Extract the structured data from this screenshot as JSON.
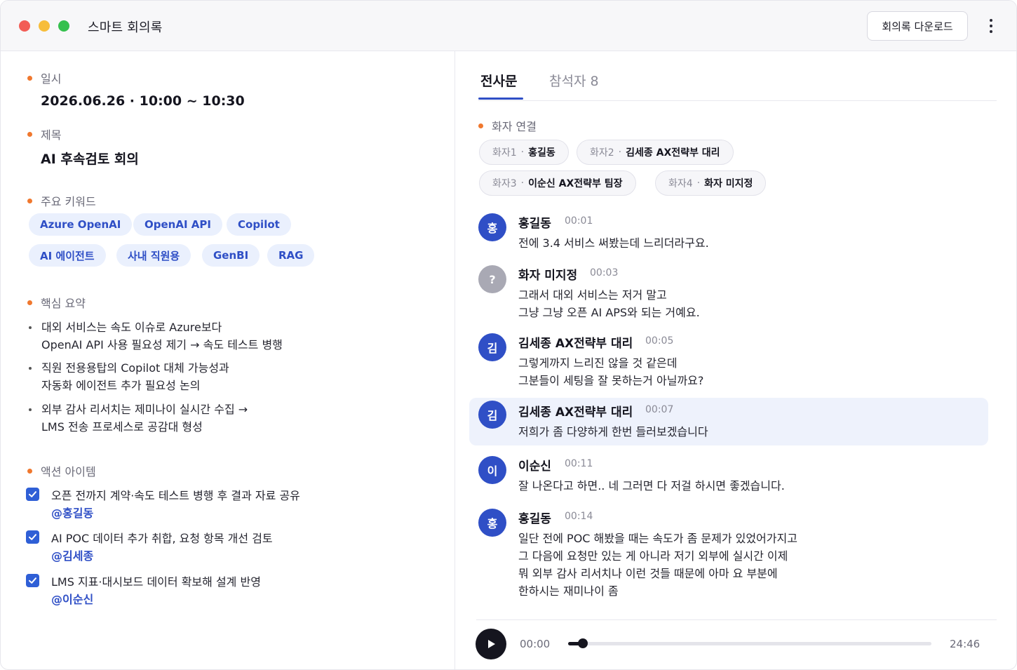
{
  "window": {
    "title": "스마트 회의록",
    "download_label": "회의록 다운로드"
  },
  "meeting": {
    "date_label": "일시",
    "date_value": "2026.06.26 · 10:00 ~ 10:30",
    "title_label": "제목",
    "title_value": "AI 후속검토 회의",
    "keywords_label": "주요 키워드",
    "keywords": [
      "Azure OpenAI",
      "OpenAI API",
      "Copilot",
      "AI 에이전트",
      "사내 직원용",
      "GenBI",
      "RAG"
    ],
    "summary_label": "핵심 요약",
    "summary": [
      {
        "line1": "대외 서비스는 속도 이슈로 Azure보다",
        "line2": "OpenAI API 사용 필요성 제기 → 속도 테스트 병행"
      },
      {
        "line1": "직원 전용용탑의 Copilot 대체 가능성과",
        "line2": "자동화 에이전트 추가 필요성 논의"
      },
      {
        "line1": "외부 감사 리서치는 제미나이 실시간 수집 →",
        "line2": "LMS 전송 프로세스로 공감대 형성"
      }
    ],
    "actions_label": "액션 아이템",
    "actions": [
      {
        "text": "오픈 전까지 계약·속도 테스트 병행 후 결과 자료 공유",
        "mention": "@홍길동",
        "checked": true
      },
      {
        "text": "AI POC 데이터 추가 취합, 요청 항목 개선 검토",
        "mention": "@김세종",
        "checked": true
      },
      {
        "text": "LMS 지표·대시보드 데이터 확보해 설계 반영",
        "mention": "@이순신",
        "checked": true
      }
    ]
  },
  "tabs": {
    "transcript": "전사문",
    "participants": "참석자 8"
  },
  "speakers_label": "화자 연결",
  "speakers": [
    {
      "id": "화자1",
      "name": "홍길동"
    },
    {
      "id": "화자2",
      "name": "김세종 AX전략부 대리"
    },
    {
      "id": "화자3",
      "name": "이순신 AX전략부 팀장"
    },
    {
      "id": "화자4",
      "name": "화자 미지정"
    }
  ],
  "transcript": [
    {
      "avatar": "홍",
      "name": "홍길동",
      "time": "00:01",
      "lines": [
        "전에 3.4 서비스 써봤는데 느리더라구요."
      ],
      "highlight": false
    },
    {
      "avatar": "?",
      "name": "화자 미지정",
      "time": "00:03",
      "lines": [
        "그래서 대외 서비스는 저거 말고",
        "그냥 그냥 오픈 AI APS와 되는 거예요."
      ],
      "highlight": false
    },
    {
      "avatar": "김",
      "name": "김세종 AX전략부 대리",
      "time": "00:05",
      "lines": [
        "그렇게까지 느리진 않을 것 같은데",
        "그분들이 세팅을 잘 못하는거 아닐까요?"
      ],
      "highlight": false
    },
    {
      "avatar": "김",
      "name": "김세종 AX전략부 대리",
      "time": "00:07",
      "lines": [
        "저희가 좀 다양하게 한번 들러보겠습니다"
      ],
      "highlight": true
    },
    {
      "avatar": "이",
      "name": "이순신",
      "time": "00:11",
      "lines": [
        "잘 나온다고 하면.. 네 그러면 다 저걸 하시면 좋겠습니다."
      ],
      "highlight": false
    },
    {
      "avatar": "홍",
      "name": "홍길동",
      "time": "00:14",
      "lines": [
        "일단 전에 POC 해봤을 때는 속도가 좀 문제가 있었어가지고",
        "그 다음에 요청만 있는 게 아니라 저기 외부에 실시간 이제",
        "뭐 외부 감사 리서치나 이런 것들 때문에 아마 요 부분에",
        "한하시는 재미나이 좀"
      ],
      "highlight": false
    }
  ],
  "player": {
    "current": "00:00",
    "total": "24:46",
    "progress_fraction": 0.04
  },
  "colors": {
    "accent": "#2f4fc6",
    "bullet_dot": "#f0782e",
    "chip_bg": "#eaf0fd",
    "highlight_bg": "#eef2fc"
  }
}
